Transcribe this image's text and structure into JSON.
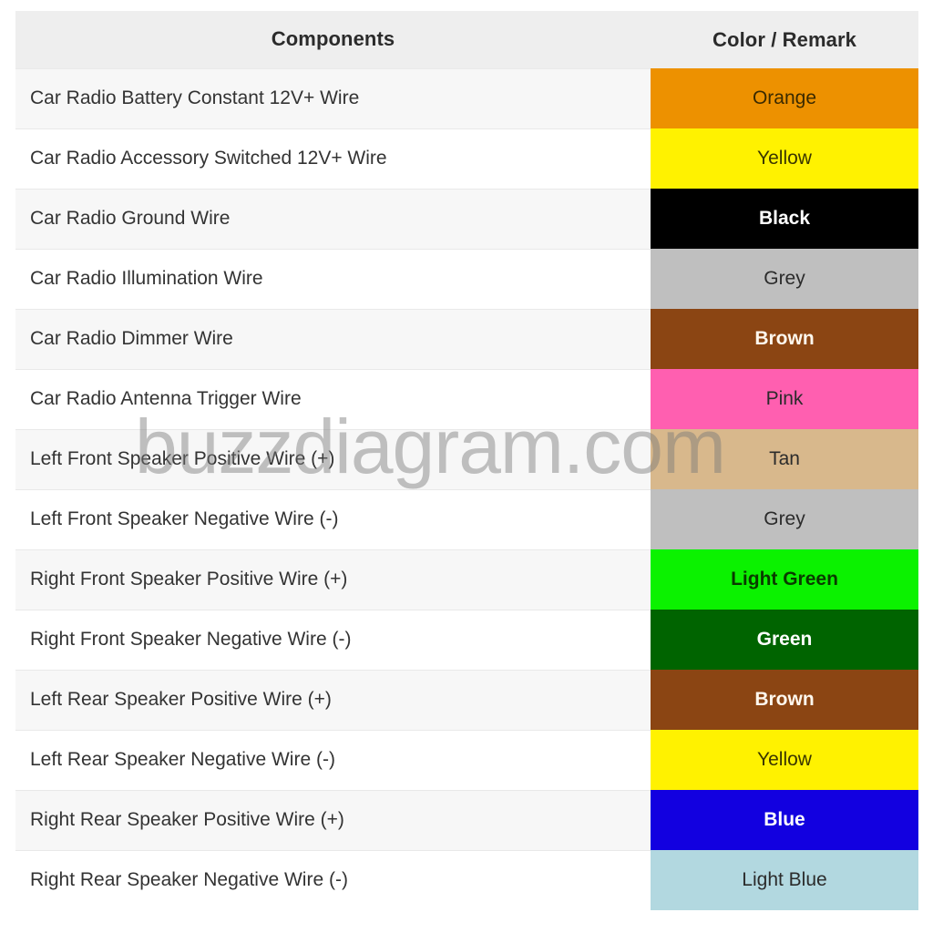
{
  "table": {
    "headers": {
      "components": "Components",
      "color_remark": "Color / Remark"
    },
    "rows": [
      {
        "component": "Car Radio Battery Constant 12V+ Wire",
        "color_label": "Orange",
        "swatch": "#ED9100",
        "text_color": "#3a2a00"
      },
      {
        "component": "Car Radio Accessory Switched 12V+ Wire",
        "color_label": "Yellow",
        "swatch": "#FFF200",
        "text_color": "#3a3500"
      },
      {
        "component": "Car Radio Ground Wire",
        "color_label": "Black",
        "swatch": "#000000",
        "text_color": "#ffffff"
      },
      {
        "component": "Car Radio Illumination Wire",
        "color_label": "Grey",
        "swatch": "#BFBFBF",
        "text_color": "#2b2b2b"
      },
      {
        "component": "Car Radio Dimmer Wire",
        "color_label": "Brown",
        "swatch": "#8B4513",
        "text_color": "#fff8ee"
      },
      {
        "component": "Car Radio Antenna Trigger Wire",
        "color_label": "Pink",
        "swatch": "#FF5FB0",
        "text_color": "#2b2b2b"
      },
      {
        "component": "Left Front Speaker Positive Wire (+)",
        "color_label": "Tan",
        "swatch": "#D8B88C",
        "text_color": "#2b2b2b"
      },
      {
        "component": "Left Front Speaker Negative Wire (-)",
        "color_label": "Grey",
        "swatch": "#BFBFBF",
        "text_color": "#2b2b2b"
      },
      {
        "component": "Right Front Speaker Positive Wire (+)",
        "color_label": "Light Green",
        "swatch": "#0BF200",
        "text_color": "#0a3a00"
      },
      {
        "component": "Right Front Speaker Negative Wire (-)",
        "color_label": "Green",
        "swatch": "#006400",
        "text_color": "#ffffff"
      },
      {
        "component": "Left Rear Speaker Positive Wire (+)",
        "color_label": "Brown",
        "swatch": "#8B4513",
        "text_color": "#fff8ee"
      },
      {
        "component": "Left Rear Speaker Negative Wire (-)",
        "color_label": "Yellow",
        "swatch": "#FFF200",
        "text_color": "#3a3500"
      },
      {
        "component": "Right Rear Speaker Positive Wire (+)",
        "color_label": "Blue",
        "swatch": "#1200E0",
        "text_color": "#ffffff"
      },
      {
        "component": "Right Rear Speaker Negative Wire (-)",
        "color_label": "Light Blue",
        "swatch": "#B2D8E0",
        "text_color": "#2b2b2b"
      }
    ]
  },
  "watermark": {
    "text": "buzzdiagram.com"
  },
  "theme": {
    "header_bg": "#eeeeee",
    "row_alt_bg": "#f7f7f7",
    "row_bg": "#ffffff",
    "border": "#e9e9e9",
    "text": "#333333"
  }
}
